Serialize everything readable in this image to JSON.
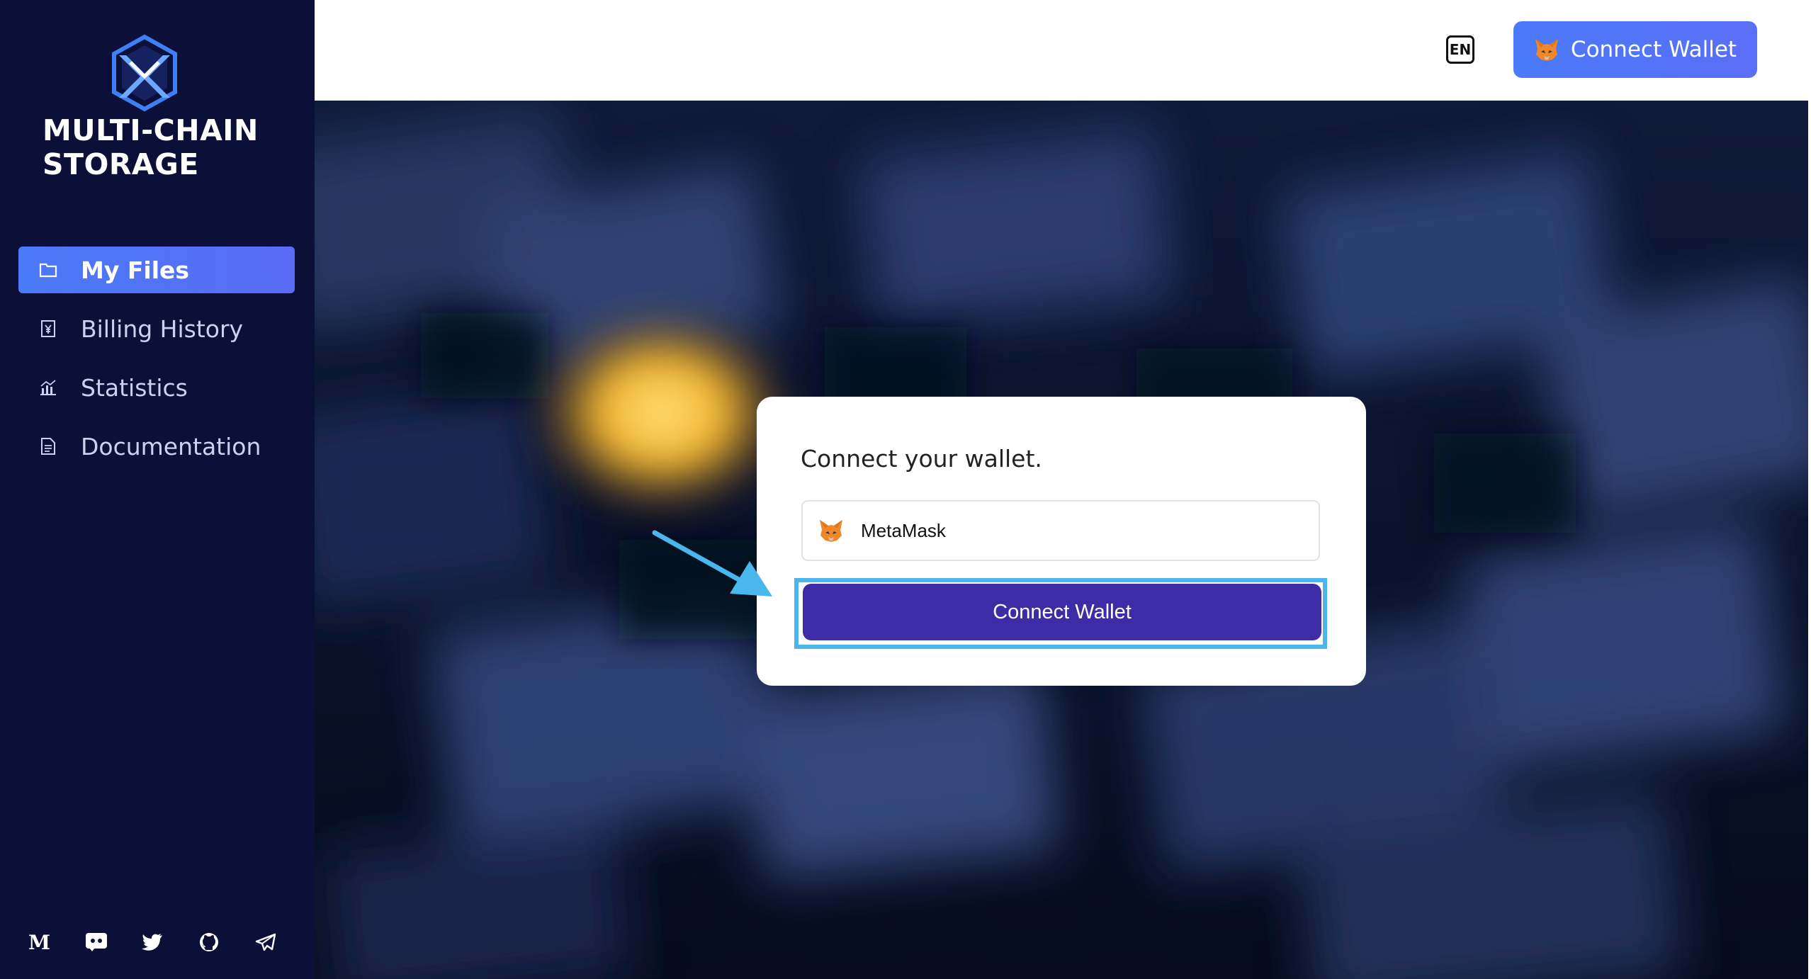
{
  "sidebar": {
    "brand_title": "MULTI-CHAIN\nSTORAGE",
    "items": [
      {
        "label": "My Files",
        "icon": "folder-icon",
        "active": true
      },
      {
        "label": "Billing History",
        "icon": "yen-receipt-icon",
        "active": false
      },
      {
        "label": "Statistics",
        "icon": "chart-icon",
        "active": false
      },
      {
        "label": "Documentation",
        "icon": "document-icon",
        "active": false
      }
    ],
    "socials": [
      "medium-icon",
      "discord-icon",
      "twitter-icon",
      "github-icon",
      "telegram-icon"
    ]
  },
  "header": {
    "lang": "EN",
    "connect_label": "Connect Wallet"
  },
  "modal": {
    "title": "Connect your wallet.",
    "wallet_option": "MetaMask",
    "connect_label": "Connect Wallet"
  },
  "colors": {
    "sidebar_bg": "#0c1038",
    "accent_blue": "#4a7af7",
    "modal_button": "#3e2ba6",
    "highlight": "#49b6ee"
  }
}
